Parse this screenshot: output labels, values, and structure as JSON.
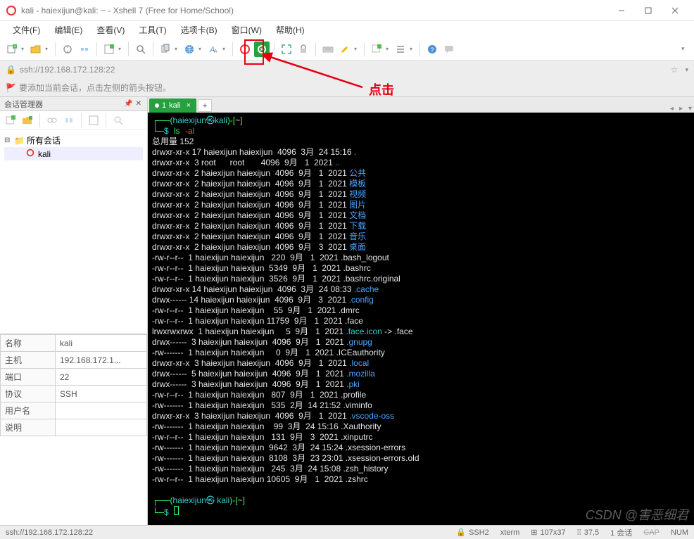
{
  "window": {
    "title": "kali - haiexijun@kali: ~ - Xshell 7 (Free for Home/School)"
  },
  "menu": [
    "文件(F)",
    "编辑(E)",
    "查看(V)",
    "工具(T)",
    "选项卡(B)",
    "窗口(W)",
    "帮助(H)"
  ],
  "address": {
    "url": "ssh://192.168.172.128:22"
  },
  "hint": "要添加当前会话，点击左侧的箭头按钮。",
  "annotation": {
    "click_label": "点击"
  },
  "sidebar": {
    "title": "会话管理器",
    "root": "所有会话",
    "session": "kali",
    "props": [
      {
        "k": "名称",
        "v": "kali"
      },
      {
        "k": "主机",
        "v": "192.168.172.1..."
      },
      {
        "k": "端口",
        "v": "22"
      },
      {
        "k": "协议",
        "v": "SSH"
      },
      {
        "k": "用户名",
        "v": ""
      },
      {
        "k": "说明",
        "v": ""
      }
    ]
  },
  "tab": {
    "index": "1",
    "name": "kali"
  },
  "terminal": {
    "prompt_cmd": "ls -al",
    "total_line": "总用量 152",
    "listing": [
      {
        "perm": "drwxr-xr-x",
        "n": "17",
        "u": "haiexijun",
        "g": "haiexijun",
        "size": "4096",
        "m": "3月",
        "d": "24",
        "t": "15:16",
        "name": ".",
        "cls": "b"
      },
      {
        "perm": "drwxr-xr-x",
        "n": "3",
        "u": "root",
        "g": "root",
        "size": "4096",
        "m": "9月",
        "d": "1",
        "t": "2021",
        "name": "..",
        "cls": "b"
      },
      {
        "perm": "drwxr-xr-x",
        "n": "2",
        "u": "haiexijun",
        "g": "haiexijun",
        "size": "4096",
        "m": "9月",
        "d": "1",
        "t": "2021",
        "name": "公共",
        "cls": "b"
      },
      {
        "perm": "drwxr-xr-x",
        "n": "2",
        "u": "haiexijun",
        "g": "haiexijun",
        "size": "4096",
        "m": "9月",
        "d": "1",
        "t": "2021",
        "name": "模板",
        "cls": "b"
      },
      {
        "perm": "drwxr-xr-x",
        "n": "2",
        "u": "haiexijun",
        "g": "haiexijun",
        "size": "4096",
        "m": "9月",
        "d": "1",
        "t": "2021",
        "name": "视频",
        "cls": "b"
      },
      {
        "perm": "drwxr-xr-x",
        "n": "2",
        "u": "haiexijun",
        "g": "haiexijun",
        "size": "4096",
        "m": "9月",
        "d": "1",
        "t": "2021",
        "name": "图片",
        "cls": "b"
      },
      {
        "perm": "drwxr-xr-x",
        "n": "2",
        "u": "haiexijun",
        "g": "haiexijun",
        "size": "4096",
        "m": "9月",
        "d": "1",
        "t": "2021",
        "name": "文档",
        "cls": "b"
      },
      {
        "perm": "drwxr-xr-x",
        "n": "2",
        "u": "haiexijun",
        "g": "haiexijun",
        "size": "4096",
        "m": "9月",
        "d": "1",
        "t": "2021",
        "name": "下载",
        "cls": "b"
      },
      {
        "perm": "drwxr-xr-x",
        "n": "2",
        "u": "haiexijun",
        "g": "haiexijun",
        "size": "4096",
        "m": "9月",
        "d": "1",
        "t": "2021",
        "name": "音乐",
        "cls": "b"
      },
      {
        "perm": "drwxr-xr-x",
        "n": "2",
        "u": "haiexijun",
        "g": "haiexijun",
        "size": "4096",
        "m": "9月",
        "d": "3",
        "t": "2021",
        "name": "桌面",
        "cls": "b"
      },
      {
        "perm": "-rw-r--r--",
        "n": "1",
        "u": "haiexijun",
        "g": "haiexijun",
        "size": "220",
        "m": "9月",
        "d": "1",
        "t": "2021",
        "name": ".bash_logout",
        "cls": "w"
      },
      {
        "perm": "-rw-r--r--",
        "n": "1",
        "u": "haiexijun",
        "g": "haiexijun",
        "size": "5349",
        "m": "9月",
        "d": "1",
        "t": "2021",
        "name": ".bashrc",
        "cls": "w"
      },
      {
        "perm": "-rw-r--r--",
        "n": "1",
        "u": "haiexijun",
        "g": "haiexijun",
        "size": "3526",
        "m": "9月",
        "d": "1",
        "t": "2021",
        "name": ".bashrc.original",
        "cls": "w"
      },
      {
        "perm": "drwxr-xr-x",
        "n": "14",
        "u": "haiexijun",
        "g": "haiexijun",
        "size": "4096",
        "m": "3月",
        "d": "24",
        "t": "08:33",
        "name": ".cache",
        "cls": "b"
      },
      {
        "perm": "drwx------",
        "n": "14",
        "u": "haiexijun",
        "g": "haiexijun",
        "size": "4096",
        "m": "9月",
        "d": "3",
        "t": "2021",
        "name": ".config",
        "cls": "b"
      },
      {
        "perm": "-rw-r--r--",
        "n": "1",
        "u": "haiexijun",
        "g": "haiexijun",
        "size": "55",
        "m": "9月",
        "d": "1",
        "t": "2021",
        "name": ".dmrc",
        "cls": "w"
      },
      {
        "perm": "-rw-r--r--",
        "n": "1",
        "u": "haiexijun",
        "g": "haiexijun",
        "size": "11759",
        "m": "9月",
        "d": "1",
        "t": "2021",
        "name": ".face",
        "cls": "w"
      },
      {
        "perm": "lrwxrwxrwx",
        "n": "1",
        "u": "haiexijun",
        "g": "haiexijun",
        "size": "5",
        "m": "9月",
        "d": "1",
        "t": "2021",
        "name": ".face.icon",
        "cls": "c",
        "suffix": " -> .face"
      },
      {
        "perm": "drwx------",
        "n": "3",
        "u": "haiexijun",
        "g": "haiexijun",
        "size": "4096",
        "m": "9月",
        "d": "1",
        "t": "2021",
        "name": ".gnupg",
        "cls": "b"
      },
      {
        "perm": "-rw-------",
        "n": "1",
        "u": "haiexijun",
        "g": "haiexijun",
        "size": "0",
        "m": "9月",
        "d": "1",
        "t": "2021",
        "name": ".ICEauthority",
        "cls": "w"
      },
      {
        "perm": "drwxr-xr-x",
        "n": "3",
        "u": "haiexijun",
        "g": "haiexijun",
        "size": "4096",
        "m": "9月",
        "d": "1",
        "t": "2021",
        "name": ".local",
        "cls": "b"
      },
      {
        "perm": "drwx------",
        "n": "5",
        "u": "haiexijun",
        "g": "haiexijun",
        "size": "4096",
        "m": "9月",
        "d": "1",
        "t": "2021",
        "name": ".mozilla",
        "cls": "b"
      },
      {
        "perm": "drwx------",
        "n": "3",
        "u": "haiexijun",
        "g": "haiexijun",
        "size": "4096",
        "m": "9月",
        "d": "1",
        "t": "2021",
        "name": ".pki",
        "cls": "b"
      },
      {
        "perm": "-rw-r--r--",
        "n": "1",
        "u": "haiexijun",
        "g": "haiexijun",
        "size": "807",
        "m": "9月",
        "d": "1",
        "t": "2021",
        "name": ".profile",
        "cls": "w"
      },
      {
        "perm": "-rw-------",
        "n": "1",
        "u": "haiexijun",
        "g": "haiexijun",
        "size": "535",
        "m": "2月",
        "d": "14",
        "t": "21:52",
        "name": ".viminfo",
        "cls": "w"
      },
      {
        "perm": "drwxr-xr-x",
        "n": "3",
        "u": "haiexijun",
        "g": "haiexijun",
        "size": "4096",
        "m": "9月",
        "d": "1",
        "t": "2021",
        "name": ".vscode-oss",
        "cls": "b"
      },
      {
        "perm": "-rw-------",
        "n": "1",
        "u": "haiexijun",
        "g": "haiexijun",
        "size": "99",
        "m": "3月",
        "d": "24",
        "t": "15:16",
        "name": ".Xauthority",
        "cls": "w"
      },
      {
        "perm": "-rw-r--r--",
        "n": "1",
        "u": "haiexijun",
        "g": "haiexijun",
        "size": "131",
        "m": "9月",
        "d": "3",
        "t": "2021",
        "name": ".xinputrc",
        "cls": "w"
      },
      {
        "perm": "-rw-------",
        "n": "1",
        "u": "haiexijun",
        "g": "haiexijun",
        "size": "9642",
        "m": "3月",
        "d": "24",
        "t": "15:24",
        "name": ".xsession-errors",
        "cls": "w"
      },
      {
        "perm": "-rw-------",
        "n": "1",
        "u": "haiexijun",
        "g": "haiexijun",
        "size": "8108",
        "m": "3月",
        "d": "23",
        "t": "23:01",
        "name": ".xsession-errors.old",
        "cls": "w"
      },
      {
        "perm": "-rw-------",
        "n": "1",
        "u": "haiexijun",
        "g": "haiexijun",
        "size": "245",
        "m": "3月",
        "d": "24",
        "t": "15:08",
        "name": ".zsh_history",
        "cls": "w"
      },
      {
        "perm": "-rw-r--r--",
        "n": "1",
        "u": "haiexijun",
        "g": "haiexijun",
        "size": "10605",
        "m": "9月",
        "d": "1",
        "t": "2021",
        "name": ".zshrc",
        "cls": "w"
      }
    ],
    "prompt2_user": "haiexijun",
    "prompt2_host": "kali",
    "prompt2_path": "~"
  },
  "status": {
    "addr": "ssh://192.168.172.128:22",
    "proto": "SSH2",
    "term": "xterm",
    "size": "107x37",
    "pos": "37,5",
    "sessions": "1 会话",
    "caps": "CAP",
    "num": "NUM"
  },
  "watermark": "CSDN @害恶细君"
}
